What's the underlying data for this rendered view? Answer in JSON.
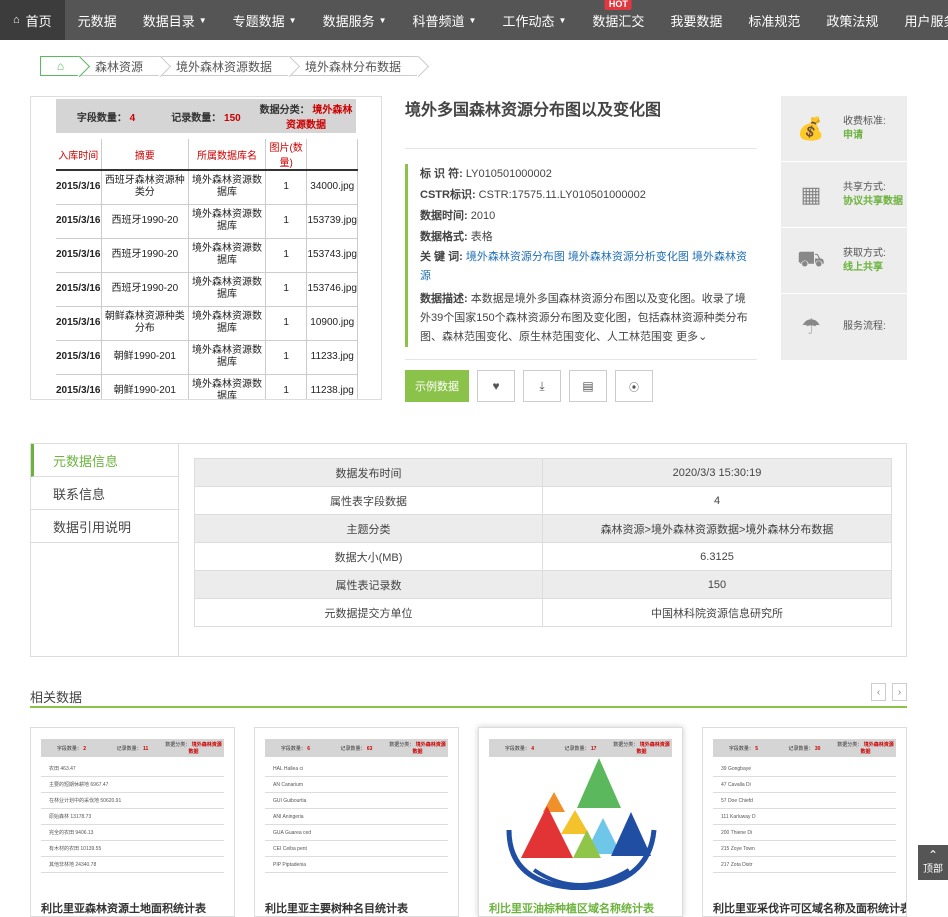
{
  "nav": {
    "home": "首页",
    "items": [
      {
        "label": "元数据",
        "caret": false
      },
      {
        "label": "数据目录",
        "caret": true
      },
      {
        "label": "专题数据",
        "caret": true
      },
      {
        "label": "数据服务",
        "caret": true
      },
      {
        "label": "科普频道",
        "caret": true
      },
      {
        "label": "工作动态",
        "caret": true
      },
      {
        "label": "数据汇交",
        "caret": false,
        "badge": "HOT"
      },
      {
        "label": "我要数据",
        "caret": false
      },
      {
        "label": "标准规范",
        "caret": false
      },
      {
        "label": "政策法规",
        "caret": false
      },
      {
        "label": "用户服务",
        "caret": true
      }
    ]
  },
  "breadcrumb": [
    "森林资源",
    "境外森林资源数据",
    "境外森林分布数据"
  ],
  "preview": {
    "field_count_label": "字段数量：",
    "field_count": "4",
    "record_count_label": "记录数量：",
    "record_count": "150",
    "category_label": "数据分类：",
    "category": "境外森林资源数据",
    "columns": [
      "入库时间",
      "摘要",
      "所属数据库名",
      "图片(数量)",
      ""
    ],
    "rows": [
      [
        "2015/3/16",
        "西班牙森林资源种类分",
        "境外森林资源数据库",
        "1",
        "34000.jpg"
      ],
      [
        "2015/3/16",
        "西班牙1990-20",
        "境外森林资源数据库",
        "1",
        "153739.jpg"
      ],
      [
        "2015/3/16",
        "西班牙1990-20",
        "境外森林资源数据库",
        "1",
        "153743.jpg"
      ],
      [
        "2015/3/16",
        "西班牙1990-20",
        "境外森林资源数据库",
        "1",
        "153746.jpg"
      ],
      [
        "2015/3/16",
        "朝鲜森林资源种类分布",
        "境外森林资源数据库",
        "1",
        "10900.jpg"
      ],
      [
        "2015/3/16",
        "朝鲜1990-201",
        "境外森林资源数据库",
        "1",
        "11233.jpg"
      ],
      [
        "2015/3/16",
        "朝鲜1990-201",
        "境外森林资源数据库",
        "1",
        "11238.jpg"
      ]
    ]
  },
  "detail": {
    "title": "境外多国森林资源分布图以及变化图",
    "id_label": "标 识 符:",
    "id": "LY010501000002",
    "cstr_label": "CSTR标识:",
    "cstr": "CSTR:17575.11.LY010501000002",
    "time_label": "数据时间:",
    "time": "2010",
    "format_label": "数据格式:",
    "format": "表格",
    "keywords_label": "关 键 词:",
    "keywords": [
      "境外森林资源分布图",
      "境外森林资源分析变化图",
      "境外森林资源"
    ],
    "desc_label": "数据描述:",
    "desc": "本数据是境外多国森林资源分布图以及变化图。收录了境外39个国家150个森林资源分布图及变化图，包括森林资源种类分布图、森林范围变化、原生林范围变化、人工林范围变",
    "more": "更多"
  },
  "buttons": {
    "sample": "示例数据",
    "favorite_icon": "heart-icon",
    "download_icon": "download-icon",
    "cart_icon": "basket-icon",
    "rss_icon": "rss-icon"
  },
  "side": [
    {
      "icon": "money-bag-icon",
      "label": "收费标准:",
      "value": "申请"
    },
    {
      "icon": "calendar-icon",
      "label": "共享方式:",
      "value": "协议共享数据"
    },
    {
      "icon": "truck-icon",
      "label": "获取方式:",
      "value": "线上共享"
    },
    {
      "icon": "umbrella-icon",
      "label": "服务流程:",
      "value": ""
    }
  ],
  "meta_tabs": [
    "元数据信息",
    "联系信息",
    "数据引用说明"
  ],
  "meta_rows": [
    [
      "数据发布时间",
      "2020/3/3 15:30:19"
    ],
    [
      "属性表字段数据",
      "4"
    ],
    [
      "主题分类",
      "森林资源>境外森林资源数据>境外森林分布数据"
    ],
    [
      "数据大小(MB)",
      "6.3125"
    ],
    [
      "属性表记录数",
      "150"
    ],
    [
      "元数据提交方单位",
      "中国林科院资源信息研究所"
    ]
  ],
  "related": {
    "title": "相关数据",
    "cards": [
      {
        "title": "利比里亚森林资源土地面积统计表",
        "fields": "2",
        "records": "11",
        "rows": [
          "农田 463.47",
          "主要的短期休耕地 6967.47",
          "在林业计划中的采伐地 50620.91",
          "原始森林 13178.73",
          "完全的农田 9406.13",
          "有木材的农田 10139.55",
          "其他非林地 24340.78"
        ]
      },
      {
        "title": "利比里亚主要树种名目统计表",
        "fields": "6",
        "records": "63",
        "rows": [
          "HAL Hallea ci",
          "AN Canarium",
          "GUI Guibourtia",
          "ANI Aningeria",
          "GUA Guarea ced",
          "CEI Ceiba pent",
          "PIP Piptadenia"
        ]
      },
      {
        "title": "利比里亚油棕种植区域名称统计表",
        "fields": "4",
        "records": "17",
        "rows": []
      },
      {
        "title": "利比里亚采伐许可区域名称及面积统计表",
        "fields": "5",
        "records": "30",
        "rows": [
          "39 Gongbaye",
          "47 Cavalla Di",
          "57 Doe Chiefd",
          "111 Karluway D",
          "200 Thiene Di",
          "215 Zoye Town",
          "217 Zota Distr"
        ]
      }
    ]
  },
  "top_button": "顶部"
}
